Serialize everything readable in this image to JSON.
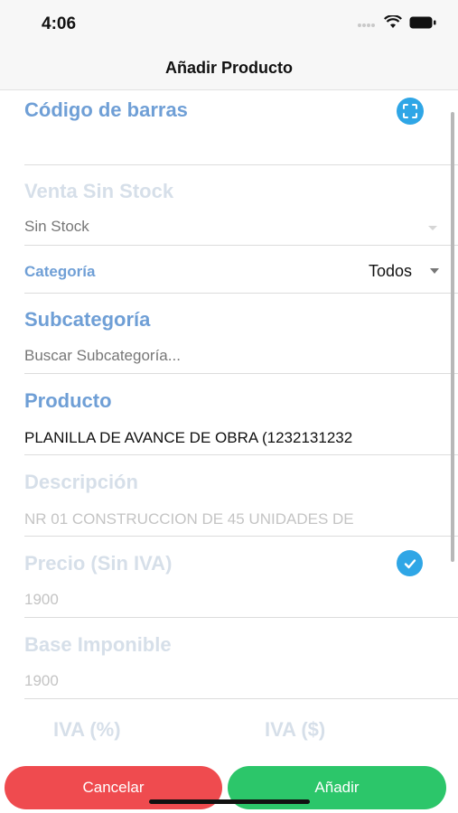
{
  "status_bar": {
    "time": "4:06"
  },
  "nav": {
    "title": "Añadir Producto"
  },
  "form": {
    "barcode": {
      "label": "Código de barras",
      "value": ""
    },
    "stock": {
      "label": "Venta Sin Stock",
      "value": "Sin Stock"
    },
    "category": {
      "label": "Categoría",
      "value": "Todos"
    },
    "subcategory": {
      "label": "Subcategoría",
      "placeholder": "Buscar Subcategoría..."
    },
    "product": {
      "label": "Producto",
      "value": "PLANILLA DE AVANCE DE OBRA (1232131232"
    },
    "description": {
      "label": "Descripción",
      "value": "NR 01 CONSTRUCCION DE 45 UNIDADES DE"
    },
    "price": {
      "label": "Precio (Sin IVA)",
      "value": "1900",
      "includes_iva_checked": true
    },
    "taxable_base": {
      "label": "Base Imponible",
      "value": "1900"
    },
    "iva_percent": {
      "label": "IVA (%)"
    },
    "iva_amount": {
      "label": "IVA ($)"
    }
  },
  "actions": {
    "cancel_label": "Cancelar",
    "add_label": "Añadir"
  },
  "colors": {
    "accent": "#2fa6e6",
    "label_blue": "#6f9fd6",
    "cancel_red": "#ef4b4f",
    "add_green": "#2cc66a"
  }
}
